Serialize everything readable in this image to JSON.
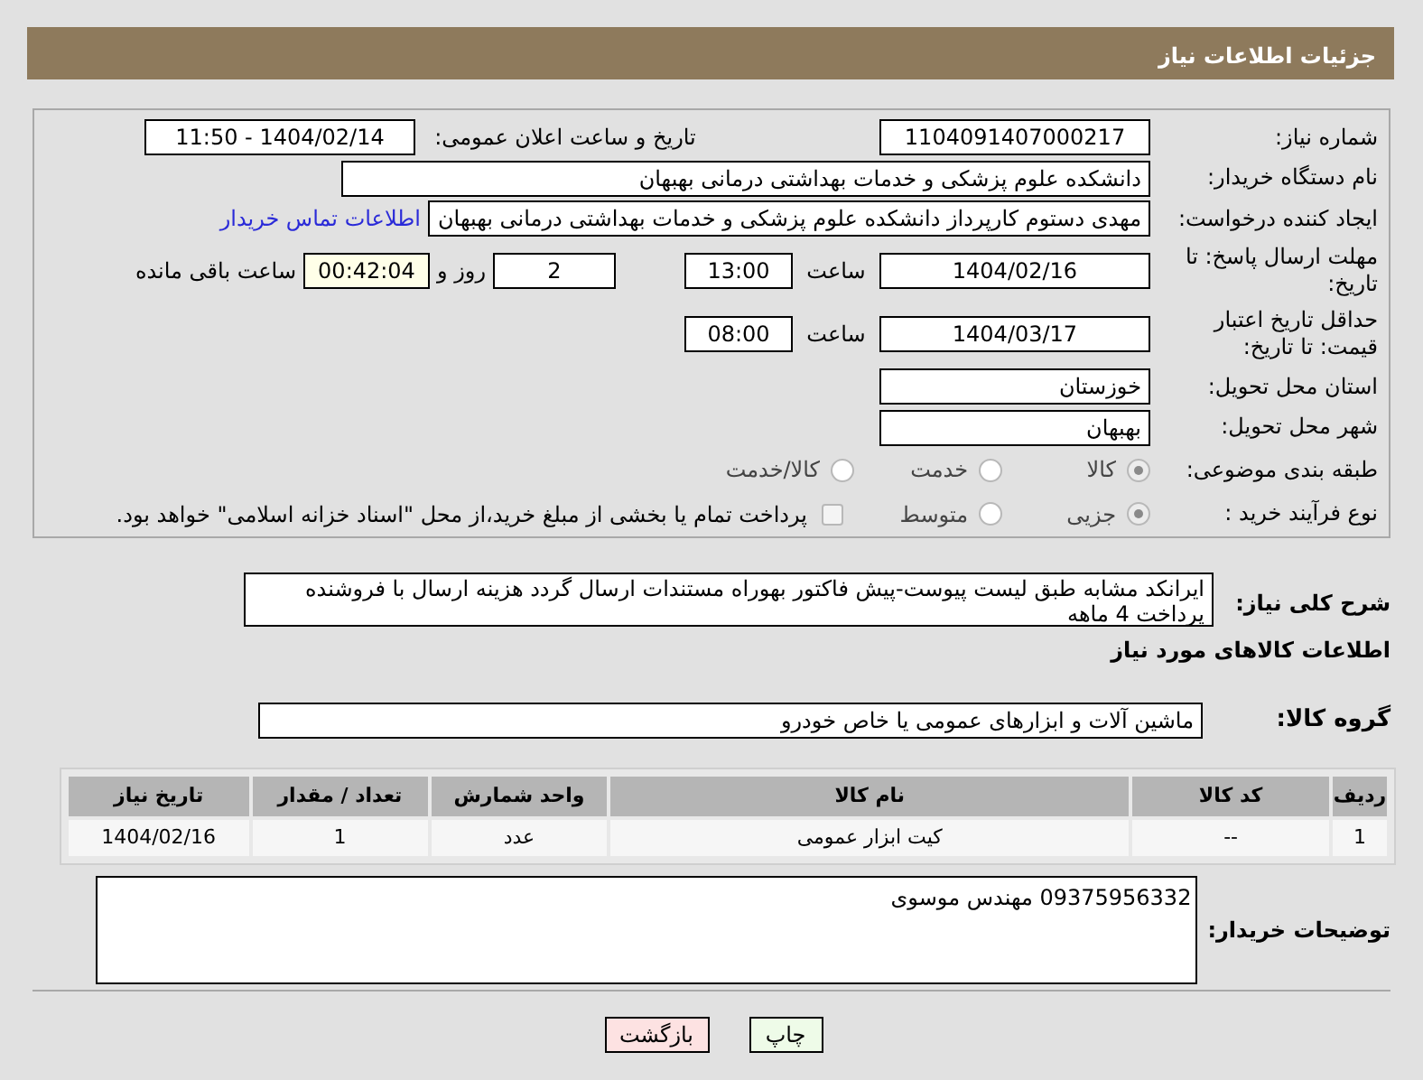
{
  "header": {
    "title": "جزئیات اطلاعات نیاز"
  },
  "need_number": {
    "label": "شماره نیاز:",
    "value": "1104091407000217"
  },
  "announcement": {
    "label": "تاریخ و ساعت اعلان عمومی:",
    "value": "1404/02/14 - 11:50"
  },
  "buyer_org": {
    "label": "نام دستگاه خریدار:",
    "value": "دانشکده علوم پزشکی و خدمات بهداشتی  درمانی بهبهان"
  },
  "requester": {
    "label": "ایجاد کننده درخواست:",
    "value": "مهدی دستوم کارپرداز دانشکده علوم پزشکی و خدمات بهداشتی  درمانی بهبهان",
    "link": "اطلاعات تماس خریدار"
  },
  "deadline": {
    "label": "مهلت ارسال پاسخ: تا تاریخ:",
    "date": "1404/02/16",
    "time_label": "ساعت",
    "time": "13:00",
    "days": "2",
    "days_label": "روز و",
    "remaining": "00:42:04",
    "remaining_label": "ساعت باقی مانده"
  },
  "validity": {
    "label": "حداقل تاریخ اعتبار قیمت: تا تاریخ:",
    "date": "1404/03/17",
    "time_label": "ساعت",
    "time": "08:00"
  },
  "province": {
    "label": "استان محل تحویل:",
    "value": "خوزستان"
  },
  "city": {
    "label": "شهر محل تحویل:",
    "value": "بهبهان"
  },
  "category": {
    "label": "طبقه بندی موضوعی:",
    "options": [
      {
        "label": "كالا",
        "selected": true
      },
      {
        "label": "خدمت",
        "selected": false
      },
      {
        "label": "كالا/خدمت",
        "selected": false
      }
    ]
  },
  "purchase_type": {
    "label": "نوع فرآیند خرید :",
    "options": [
      {
        "label": "جزیی",
        "selected": true
      },
      {
        "label": "متوسط",
        "selected": false
      }
    ],
    "treasury": {
      "label": "پرداخت تمام یا بخشی از مبلغ خرید،از محل \"اسناد خزانه اسلامی\" خواهد بود.",
      "checked": false
    }
  },
  "description": {
    "label": "شرح کلی نیاز:",
    "value": "ایرانکد مشابه طبق لیست پیوست-پیش فاکتور بهوراه مستندات ارسال گردد هزینه ارسال با فروشنده پرداخت 4 ماهه"
  },
  "goods_heading": "اطلاعات کالاهای مورد نیاز",
  "goods_group": {
    "label": "گروه کالا:",
    "value": "ماشین آلات و ابزارهای عمومی یا خاص خودرو"
  },
  "table": {
    "columns": [
      "ردیف",
      "کد کالا",
      "نام کالا",
      "واحد شمارش",
      "تعداد / مقدار",
      "تاریخ نیاز"
    ],
    "rows": [
      [
        "1",
        "--",
        "کیت ابزار عمومی",
        "عدد",
        "1",
        "1404/02/16"
      ]
    ]
  },
  "buyer_notes": {
    "label": "توضیحات خریدار:",
    "value": "09375956332 مهندس موسوی"
  },
  "buttons": [
    {
      "label": "چاپ",
      "kind": "print"
    },
    {
      "label": "بازگشت",
      "kind": "back"
    }
  ]
}
